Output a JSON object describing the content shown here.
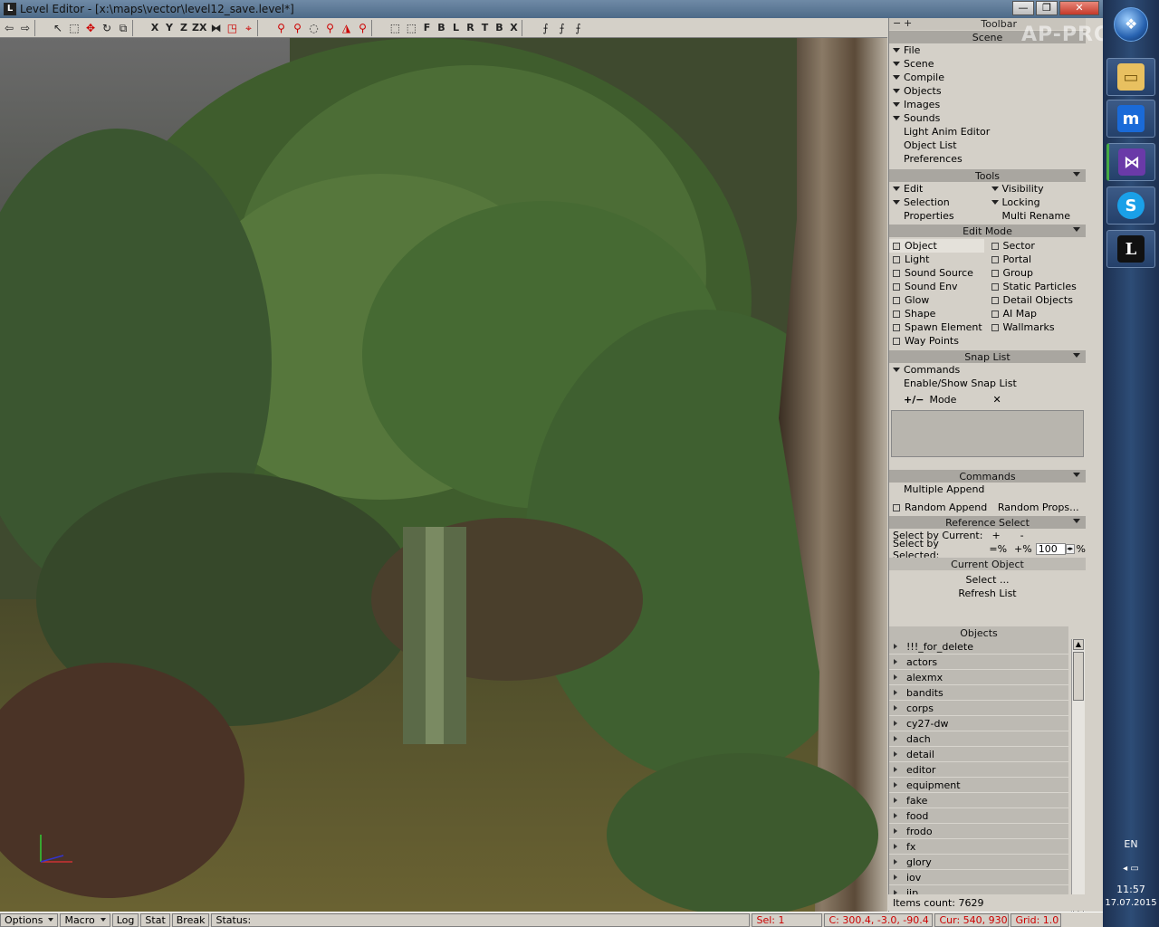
{
  "window": {
    "app_icon": "L",
    "title": "Level Editor - [x:\\maps\\vector\\level12_save.level*]",
    "min": "—",
    "max": "❐",
    "close": "✕"
  },
  "toolbar_text": [
    "Z",
    "ZX",
    "X",
    "Y",
    "F",
    "B",
    "L",
    "R",
    "T",
    "B",
    "X"
  ],
  "panel": {
    "title": "Toolbar",
    "scene_header": "Scene",
    "scene_items": [
      {
        "label": "File",
        "arrow": true
      },
      {
        "label": "Scene",
        "arrow": true
      },
      {
        "label": "Compile",
        "arrow": true
      },
      {
        "label": "Objects",
        "arrow": true
      },
      {
        "label": "Images",
        "arrow": true
      },
      {
        "label": "Sounds",
        "arrow": true
      },
      {
        "label": "Light Anim Editor",
        "arrow": false
      },
      {
        "label": "Object List",
        "arrow": false
      },
      {
        "label": "Preferences",
        "arrow": false
      }
    ],
    "tools_header": "Tools",
    "tools": {
      "edit": "Edit",
      "visibility": "Visibility",
      "selection": "Selection",
      "locking": "Locking",
      "properties": "Properties",
      "multi_rename": "Multi Rename"
    },
    "editmode_header": "Edit Mode",
    "editmode_left": [
      "Object",
      "Light",
      "Sound Source",
      "Sound Env",
      "Glow",
      "Shape",
      "Spawn Element",
      "Way Points"
    ],
    "editmode_right": [
      "Sector",
      "Portal",
      "Group",
      "Static Particles",
      "Detail Objects",
      "AI Map",
      "Wallmarks"
    ],
    "snap_header": "Snap List",
    "snap_commands": "Commands",
    "snap_enable": "Enable/Show Snap List",
    "snap_mode_sign": "+/−",
    "snap_mode": "Mode",
    "snap_x": "✕",
    "commands_header": "Commands",
    "multiple_append": "Multiple Append",
    "random_append": "Random Append",
    "random_props": "Random Props...",
    "refselect_header": "Reference Select",
    "select_by_current": "Select by Current:",
    "select_by_selected": "Select by Selected:",
    "plus": "+",
    "minus": "-",
    "eq_pct": "=%",
    "plus_pct": "+%",
    "pct_value": "100",
    "pct_sign": "%",
    "current_object_header": "Current Object",
    "select": "Select ...",
    "refresh": "Refresh List",
    "objects_header": "Objects",
    "objects": [
      "!!!_for_delete",
      "actors",
      "alexmx",
      "bandits",
      "corps",
      "cy27-dw",
      "dach",
      "detail",
      "editor",
      "equipment",
      "fake",
      "food",
      "frodo",
      "fx",
      "glory",
      "iov",
      "jip"
    ],
    "items_count": "Items count: 7629"
  },
  "status": {
    "options": "Options",
    "macro": "Macro",
    "log": "Log",
    "stat": "Stat",
    "brk": "Break",
    "status_label": "Status:",
    "sel": "Sel: 1",
    "coords": "C: 300.4, -3.0, -90.4",
    "cur": "Cur: 540, 930",
    "grid": "Grid: 1.0"
  },
  "watermark": "AP-PRO.RU",
  "taskbar": {
    "lang": "EN",
    "time": "11:57",
    "date": "17.07.2015",
    "apps": [
      "folder-icon",
      "maxthon-icon",
      "visual-studio-icon",
      "skype-icon",
      "level-editor-icon"
    ]
  },
  "colors": {
    "accent_red": "#cc0000",
    "panel_bg": "#d4d0c8",
    "header_bg": "#a9a6a0"
  }
}
